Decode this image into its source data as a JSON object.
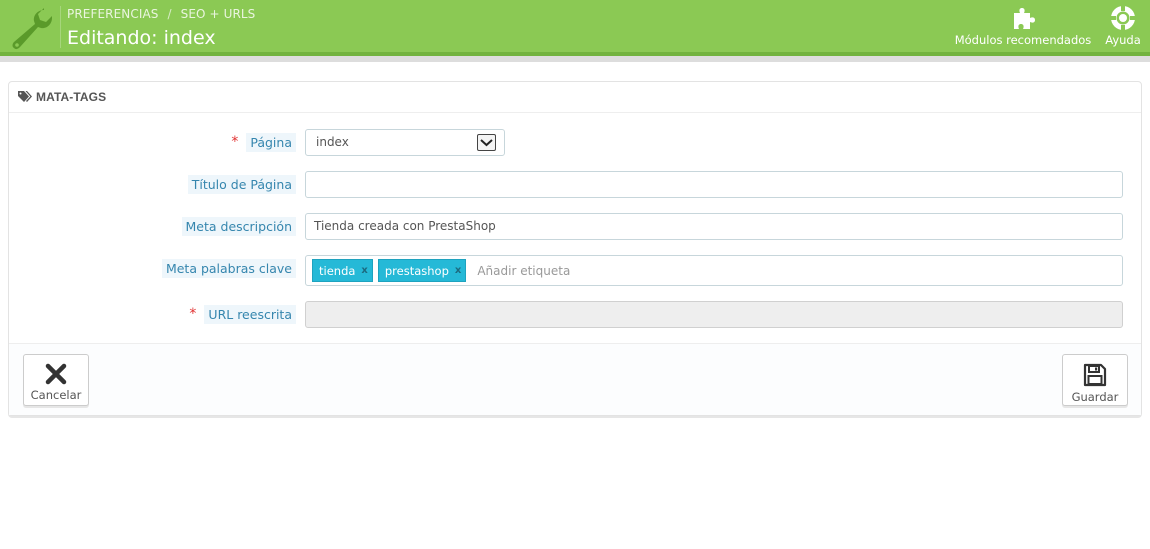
{
  "header": {
    "breadcrumb": [
      "PREFERENCIAS",
      "SEO + URLS"
    ],
    "breadcrumb_sep": "/",
    "title": "Editando: index",
    "toolbar": {
      "modules_label": "Módulos recomendados",
      "help_label": "Ayuda"
    },
    "icons": [
      "wrench-icon",
      "puzzle-icon",
      "lifebuoy-icon"
    ]
  },
  "panel": {
    "heading": "MATA-TAGS",
    "heading_icon": "tags-icon",
    "fields": {
      "page": {
        "label": "Página",
        "required": "*",
        "value": "index"
      },
      "page_title": {
        "label": "Título de Página",
        "value": ""
      },
      "meta_description": {
        "label": "Meta descripción",
        "value": "Tienda creada con PrestaShop"
      },
      "meta_keywords": {
        "label": "Meta palabras clave",
        "tags": [
          "tienda",
          "prestashop"
        ],
        "tag_remove": "x",
        "placeholder": "Añadir etiqueta"
      },
      "url_rewrite": {
        "label": "URL reescrita",
        "required": "*",
        "value": ""
      }
    },
    "footer": {
      "cancel_label": "Cancelar",
      "save_label": "Guardar"
    }
  },
  "colors": {
    "header_bg": "#8bc954",
    "label_text": "#3586ae",
    "tag_bg": "#25b9d7",
    "required": "#e13131"
  }
}
